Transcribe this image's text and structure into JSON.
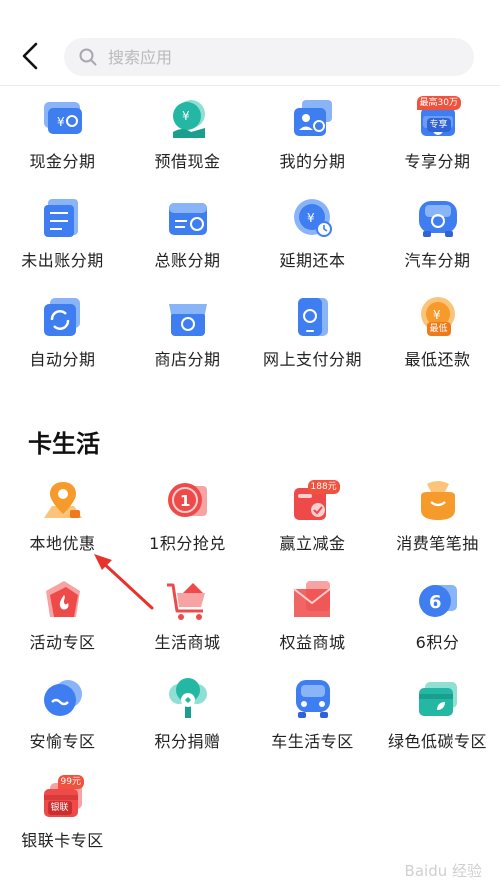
{
  "search": {
    "placeholder": "搜索应用"
  },
  "installment_apps": [
    {
      "label": "现金分期",
      "icon": "cash-installment-icon"
    },
    {
      "label": "预借现金",
      "icon": "cash-advance-icon"
    },
    {
      "label": "我的分期",
      "icon": "my-installment-icon"
    },
    {
      "label": "专享分期",
      "icon": "exclusive-installment-icon",
      "badge_top": "最高30万",
      "badge_bottom": "专享"
    },
    {
      "label": "未出账分期",
      "icon": "unbilled-installment-icon"
    },
    {
      "label": "总账分期",
      "icon": "ledger-installment-icon"
    },
    {
      "label": "延期还本",
      "icon": "deferred-principal-icon"
    },
    {
      "label": "汽车分期",
      "icon": "car-installment-icon"
    },
    {
      "label": "自动分期",
      "icon": "auto-installment-icon"
    },
    {
      "label": "商店分期",
      "icon": "store-installment-icon"
    },
    {
      "label": "网上支付分期",
      "icon": "online-payment-installment-icon"
    },
    {
      "label": "最低还款",
      "icon": "minimum-payment-icon",
      "badge": "最低"
    }
  ],
  "section": {
    "title": "卡生活"
  },
  "life_apps": [
    {
      "label": "本地优惠",
      "icon": "local-deals-icon"
    },
    {
      "label": "1积分抢兑",
      "icon": "one-point-redeem-icon"
    },
    {
      "label": "赢立减金",
      "icon": "win-discount-icon",
      "badge": "188元"
    },
    {
      "label": "消费笔笔抽",
      "icon": "spending-lottery-icon"
    },
    {
      "label": "活动专区",
      "icon": "events-zone-icon"
    },
    {
      "label": "生活商城",
      "icon": "life-mall-icon"
    },
    {
      "label": "权益商城",
      "icon": "benefits-mall-icon"
    },
    {
      "label": "6积分",
      "icon": "six-points-icon"
    },
    {
      "label": "安愉专区",
      "icon": "anyu-zone-icon"
    },
    {
      "label": "积分捐赠",
      "icon": "points-donation-icon"
    },
    {
      "label": "车生活专区",
      "icon": "car-life-zone-icon"
    },
    {
      "label": "绿色低碳专区",
      "icon": "green-low-carbon-zone-icon"
    },
    {
      "label": "银联卡专区",
      "icon": "unionpay-card-zone-icon",
      "badge": "99元",
      "badge_bottom": "银联"
    }
  ],
  "watermark": "Baidu 经验",
  "colors": {
    "blue": "#3f7ef0",
    "teal": "#23b7a4",
    "orange": "#f59a2b",
    "red": "#ef4a4a",
    "arrow": "#e8322c"
  }
}
